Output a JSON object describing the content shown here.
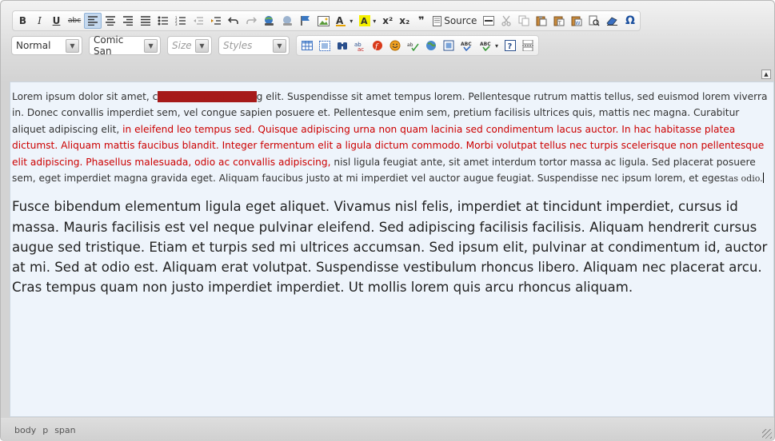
{
  "toolbar_row1": {
    "bold": "B",
    "italic": "I",
    "underline": "U",
    "strike": "abc",
    "superscript": "x²",
    "subscript": "x₂",
    "blockquote": "❞",
    "source_label": "Source",
    "special_char": "Ω"
  },
  "toolbar_row2": {
    "format_value": "Normal",
    "font_value": "Comic San",
    "size_placeholder": "Size",
    "styles_placeholder": "Styles"
  },
  "content": {
    "p1_a": "Lorem ipsum dolor sit amet, c",
    "p1_sel": "onsectetur adipiscin",
    "p1_b": "g elit. Suspendisse sit amet tempus lorem. Pellentesque rutrum mattis tellus, sed euismod lorem viverra in. Donec convallis imperdiet sem, vel congue sapien posuere et. Pellentesque enim sem, pretium facilisis ultrices quis, mattis nec magna. Curabitur aliquet adipiscing elit, ",
    "p1_red": "in eleifend leo tempus sed. Quisque adipiscing urna non quam lacinia sed condimentum lacus auctor. In hac habitasse platea dictumst. Aliquam mattis faucibus blandit. Integer fermentum elit a ligula dictum commodo. Morbi volutpat tellus nec turpis scelerisque non pellentesque elit adipiscing. Phasellus malesuada, odio ac convallis adipiscing,",
    "p1_c": " nisl ligula feugiat ante, sit amet interdum tortor massa ac ligula. Sed placerat posuere sem, eget imperdiet magna gravida eget. Aliquam faucibus justo at mi imperdiet vel auctor augue feugiat. Suspendisse nec ipsum lorem, et eges",
    "p1_small": "tas odio.",
    "p2": "Fusce bibendum elementum ligula eget aliquet. Vivamus nisl felis, imperdiet at tincidunt imperdiet, cursus id massa. Mauris facilisis est vel neque pulvinar eleifend. Sed adipiscing facilisis facilisis. Aliquam hendrerit cursus augue sed tristique. Etiam et turpis sed mi ultrices accumsan. Sed ipsum elit, pulvinar at condimentum id, auctor at mi. Sed at odio est. Aliquam erat volutpat. Suspendisse vestibulum rhoncus libero. Aliquam nec placerat arcu. Cras tempus quam non justo imperdiet imperdiet. Ut mollis lorem quis arcu rhoncus aliquam."
  },
  "status_path": [
    "body",
    "p",
    "span"
  ],
  "colors": {
    "red_text": "#cc0000",
    "selection": "#a61a1a",
    "content_bg": "#eef4fb"
  }
}
